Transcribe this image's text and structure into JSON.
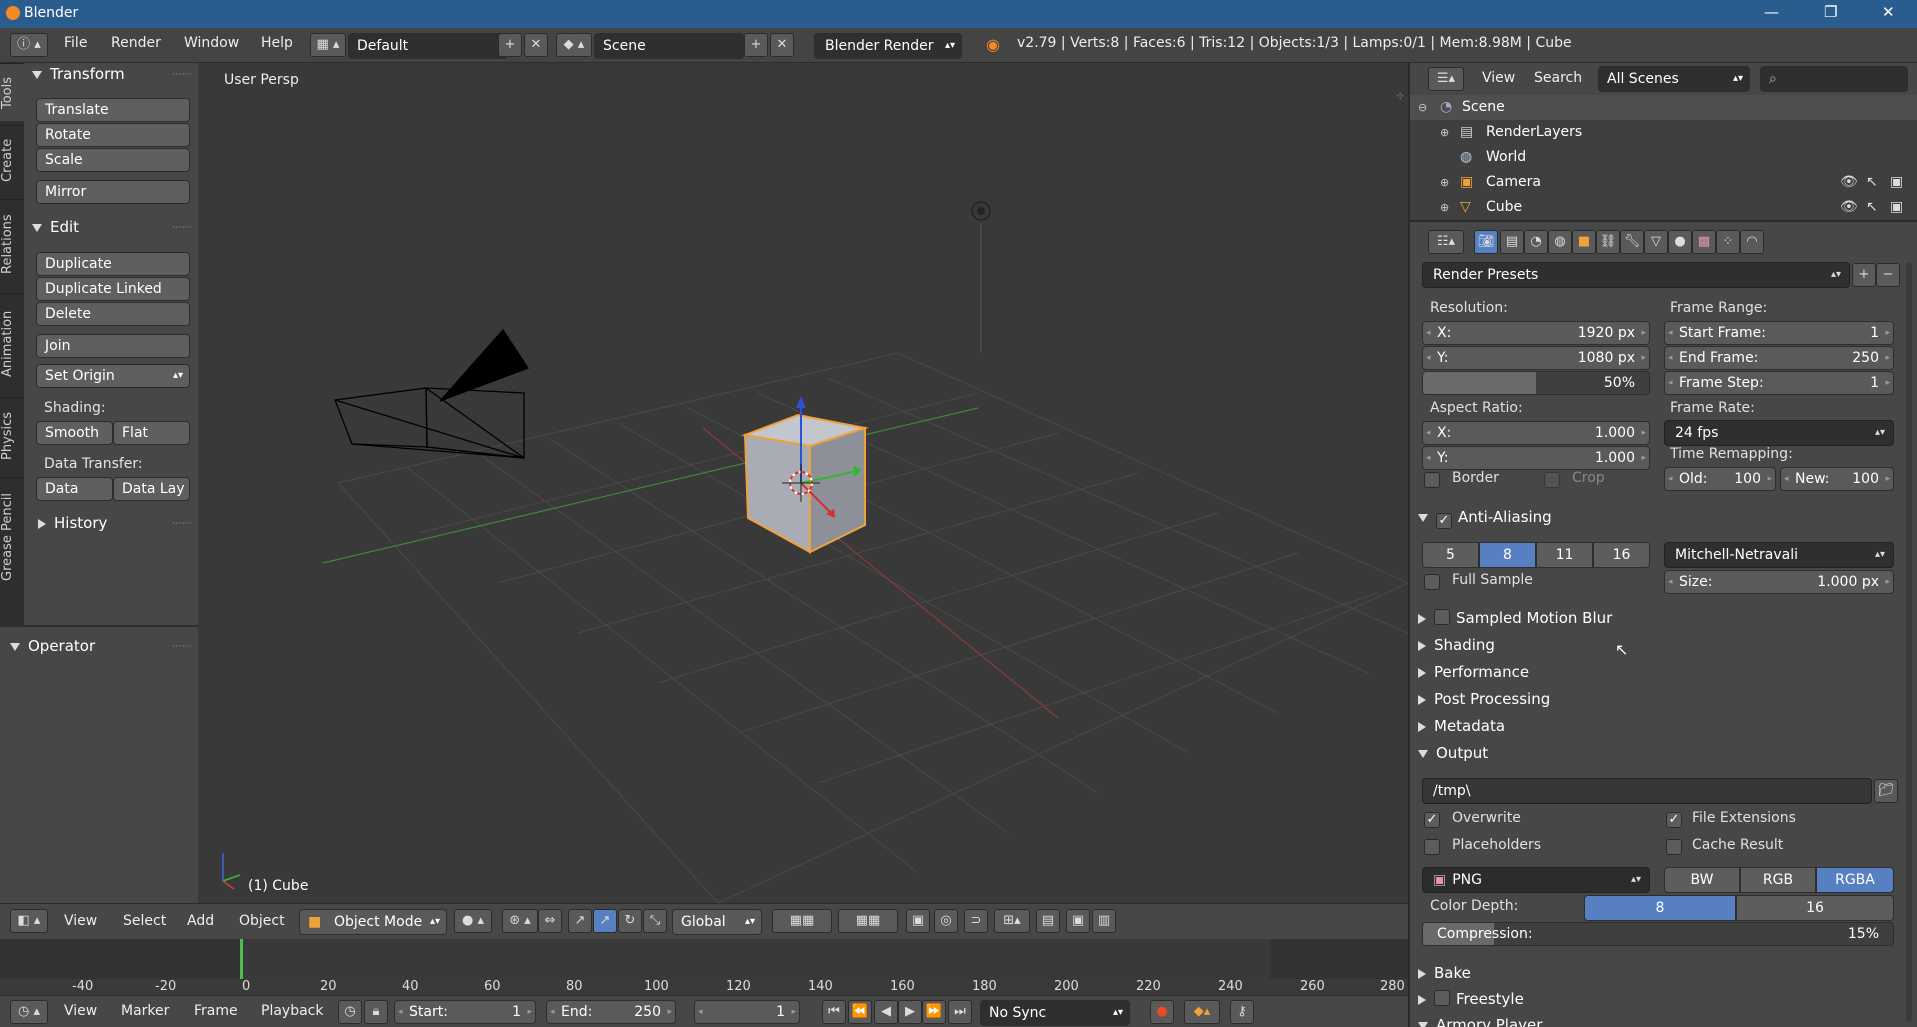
{
  "window": {
    "title": "Blender",
    "min": "—",
    "max": "❐",
    "close": "✕"
  },
  "header": {
    "menus": [
      "File",
      "Render",
      "Window",
      "Help"
    ],
    "layout": "Default",
    "scene": "Scene",
    "engine": "Blender Render",
    "stats": "v2.79 | Verts:8 | Faces:6 | Tris:12 | Objects:1/3 | Lamps:0/1 | Mem:8.98M | Cube"
  },
  "left_tabs": [
    "Tools",
    "Create",
    "Relations",
    "Animation",
    "Physics",
    "Grease Pencil"
  ],
  "tools": {
    "transform": {
      "title": "Transform",
      "buttons": [
        "Translate",
        "Rotate",
        "Scale",
        "Mirror"
      ]
    },
    "edit": {
      "title": "Edit",
      "buttons": [
        "Duplicate",
        "Duplicate Linked",
        "Delete",
        "Join"
      ],
      "set_origin": "Set Origin"
    },
    "shading": {
      "label": "Shading:",
      "smooth": "Smooth",
      "flat": "Flat"
    },
    "data_transfer": {
      "label": "Data Transfer:",
      "data": "Data",
      "data_lay": "Data Lay"
    },
    "history": "History",
    "operator": "Operator"
  },
  "viewport": {
    "view_label": "User Persp",
    "object_label": "(1) Cube"
  },
  "view_header": {
    "menus": [
      "View",
      "Select",
      "Add",
      "Object"
    ],
    "mode": "Object Mode",
    "orientation": "Global"
  },
  "timeline": {
    "ticks": [
      "-40",
      "-20",
      "0",
      "20",
      "40",
      "60",
      "80",
      "100",
      "120",
      "140",
      "160",
      "180",
      "200",
      "220",
      "240",
      "260",
      "280"
    ],
    "menus": [
      "View",
      "Marker",
      "Frame",
      "Playback"
    ],
    "start_label": "Start:",
    "start": "1",
    "end_label": "End:",
    "end": "250",
    "current": "1",
    "sync": "No Sync"
  },
  "outliner": {
    "menus": [
      "View",
      "Search"
    ],
    "filter": "All Scenes",
    "items": [
      "Scene",
      "RenderLayers",
      "World",
      "Camera",
      "Cube"
    ]
  },
  "properties": {
    "presets": "Render Presets",
    "resolution": {
      "label": "Resolution:",
      "x_label": "X:",
      "x": "1920 px",
      "y_label": "Y:",
      "y": "1080 px",
      "percent": "50%",
      "percent_value": 0.5
    },
    "frame_range": {
      "label": "Frame Range:",
      "start_label": "Start Frame:",
      "start": "1",
      "end_label": "End Frame:",
      "end": "250",
      "step_label": "Frame Step:",
      "step": "1"
    },
    "aspect": {
      "label": "Aspect Ratio:",
      "x_label": "X:",
      "x": "1.000",
      "y_label": "Y:",
      "y": "1.000"
    },
    "frame_rate": {
      "label": "Frame Rate:",
      "value": "24 fps"
    },
    "remap": {
      "label": "Time Remapping:",
      "old_label": "Old:",
      "old": "100",
      "new_label": "New:",
      "new": "100"
    },
    "border": "Border",
    "crop": "Crop",
    "aa": {
      "title": "Anti-Aliasing",
      "samples": [
        "5",
        "8",
        "11",
        "16"
      ],
      "selected": "8",
      "filter": "Mitchell-Netravali",
      "full_sample": "Full Sample",
      "size_label": "Size:",
      "size": "1.000 px"
    },
    "sections": [
      "Sampled Motion Blur",
      "Shading",
      "Performance",
      "Post Processing",
      "Metadata"
    ],
    "output": {
      "title": "Output",
      "path": "/tmp\\",
      "overwrite": "Overwrite",
      "file_extensions": "File Extensions",
      "placeholders": "Placeholders",
      "cache_result": "Cache Result",
      "format": "PNG",
      "color_modes": [
        "BW",
        "RGB",
        "RGBA"
      ],
      "color_selected": "RGBA",
      "depth_label": "Color Depth:",
      "depths": [
        "8",
        "16"
      ],
      "depth_selected": "8",
      "compression_label": "Compression:",
      "compression": "15%",
      "compression_value": 0.15
    },
    "bottom_sections": [
      "Bake",
      "Freestyle",
      "Armory Player"
    ]
  },
  "colors": {
    "accent": "#5680c2",
    "title_bar": "#2b5c8e",
    "selection": "#f0a23a"
  }
}
